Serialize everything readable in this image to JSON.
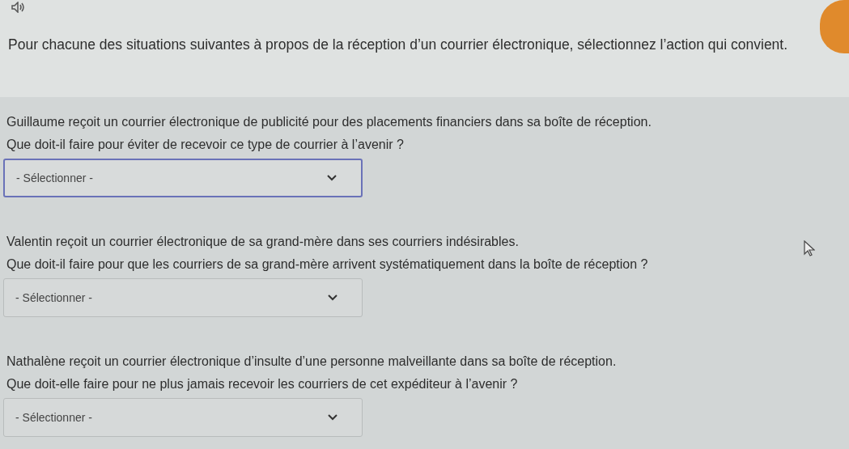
{
  "instruction": "Pour chacune des situations suivantes à propos de la réception d’un courrier électronique, sélectionnez l’action qui convient.",
  "questions": [
    {
      "situation": "Guillaume reçoit un courrier électronique de publicité pour des placements financiers dans sa boîte de réception.",
      "question": "Que doit-il faire pour éviter de recevoir ce type de courrier à l’avenir ?",
      "select": {
        "value": "- Sélectionner -",
        "focused": true
      }
    },
    {
      "situation": "Valentin reçoit un courrier électronique de sa grand-mère dans ses courriers indésirables.",
      "question": "Que doit-il faire pour que les courriers de sa grand-mère arrivent systématiquement dans la boîte de réception ?",
      "select": {
        "value": "- Sélectionner -",
        "focused": false
      }
    },
    {
      "situation": "Nathalène reçoit un courrier électronique d’insulte d’une personne malveillante dans sa boîte de réception.",
      "question": "Que doit-elle faire pour ne plus jamais recevoir les courriers de cet expéditeur à l’avenir ?",
      "select": {
        "value": "- Sélectionner -",
        "focused": false
      }
    }
  ]
}
